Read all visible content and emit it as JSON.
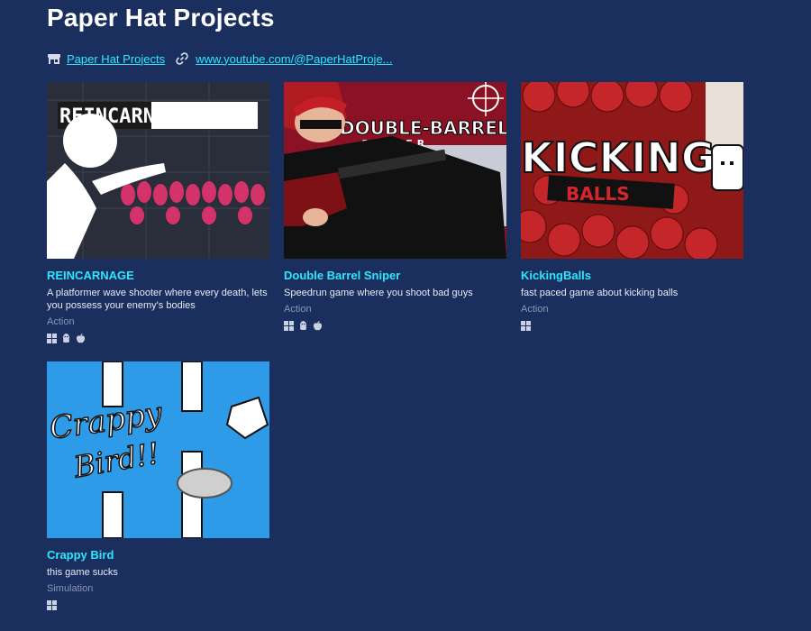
{
  "page": {
    "title": "Paper Hat Projects"
  },
  "links": {
    "store_label": "Paper Hat Projects",
    "youtube_label": "www.youtube.com/@PaperHatProje..."
  },
  "games": [
    {
      "title": "REINCARNAGE",
      "description": "A platformer wave shooter where every death, lets you possess your enemy's bodies",
      "genre": "Action",
      "platforms": [
        "windows-icon",
        "linux-icon",
        "apple-icon"
      ],
      "thumb_text": "REINCARNAGE"
    },
    {
      "title": "Double Barrel Sniper",
      "description": "Speedrun game where you shoot bad guys",
      "genre": "Action",
      "platforms": [
        "windows-icon",
        "linux-icon",
        "apple-icon"
      ],
      "thumb_text_1": "DOUBLE-BARREL",
      "thumb_text_2": "SNIPER"
    },
    {
      "title": "KickingBalls",
      "description": "fast paced game about kicking balls",
      "genre": "Action",
      "platforms": [
        "windows-icon"
      ],
      "thumb_text_1": "KICKING",
      "thumb_text_2": "BALLS"
    },
    {
      "title": "Crappy Bird",
      "description": "this game sucks",
      "genre": "Simulation",
      "platforms": [
        "windows-icon"
      ],
      "thumb_text_1": "Crappy",
      "thumb_text_2": "Bird!!"
    }
  ],
  "colors": {
    "background": "#1a2f5e",
    "link": "#2ee6ff",
    "genre": "#8a96b4"
  }
}
